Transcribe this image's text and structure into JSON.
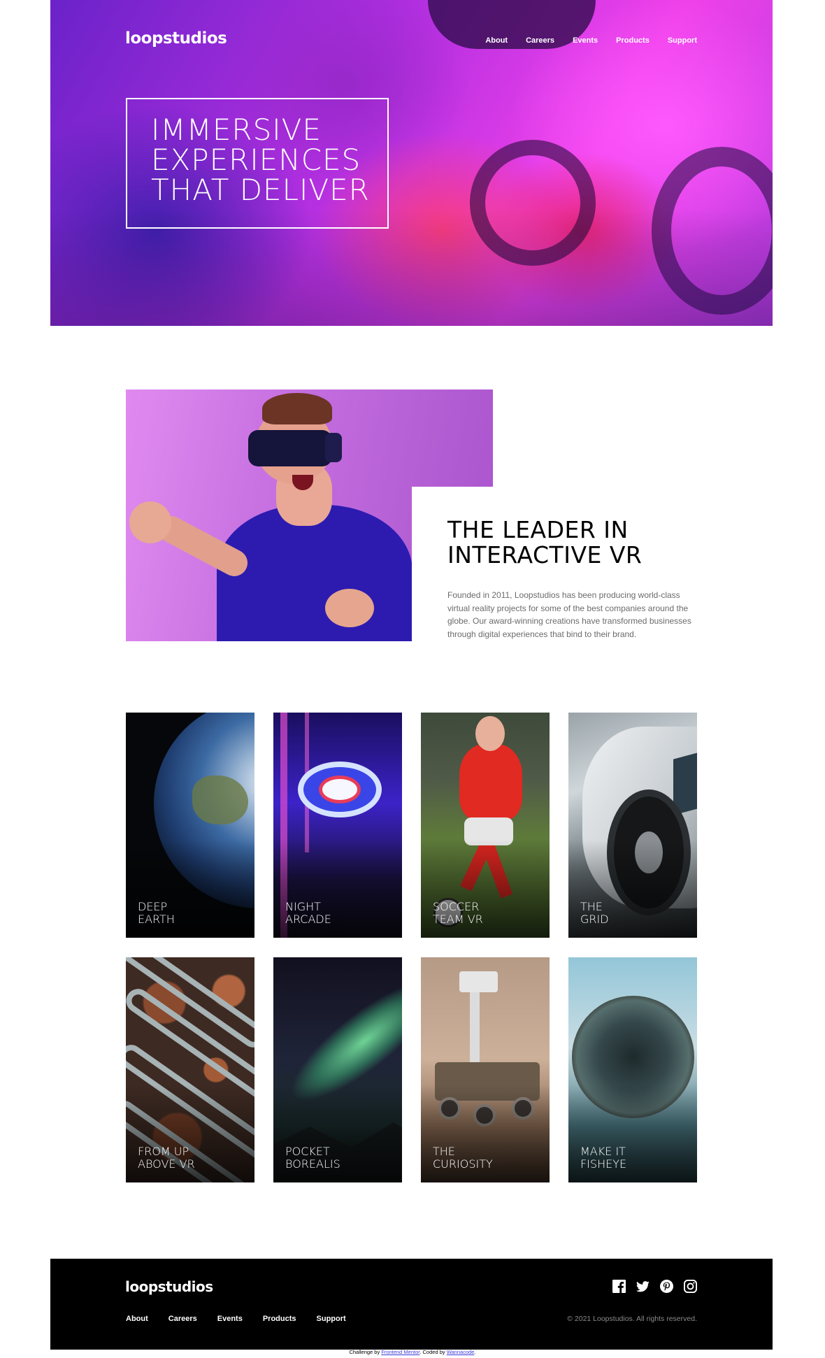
{
  "brand": "loopstudios",
  "nav": [
    "About",
    "Careers",
    "Events",
    "Products",
    "Support"
  ],
  "hero": {
    "headline": [
      "IMMERSIVE",
      "EXPERIENCES",
      "THAT DELIVER"
    ]
  },
  "intro": {
    "title": [
      "THE LEADER IN",
      "INTERACTIVE VR"
    ],
    "body": "Founded in 2011, Loopstudios has been producing world-class virtual reality projects for some of the best companies around the globe. Our award-winning creations have transformed businesses through digital experiences that bind to their brand."
  },
  "creations": [
    {
      "title": [
        "DEEP",
        "EARTH"
      ]
    },
    {
      "title": [
        "NIGHT",
        "ARCADE"
      ]
    },
    {
      "title": [
        "SOCCER",
        "TEAM VR"
      ]
    },
    {
      "title": [
        "THE",
        "GRID"
      ]
    },
    {
      "title": [
        "FROM UP",
        "ABOVE VR"
      ]
    },
    {
      "title": [
        "POCKET",
        "BOREALIS"
      ]
    },
    {
      "title": [
        "THE",
        "CURIOSITY"
      ]
    },
    {
      "title": [
        "MAKE IT",
        "FISHEYE"
      ]
    }
  ],
  "footer": {
    "social": [
      "facebook-icon",
      "twitter-icon",
      "pinterest-icon",
      "instagram-icon"
    ],
    "copyright": "© 2021 Loopstudios. All rights reserved."
  },
  "attribution": {
    "prefix": "Challenge by ",
    "link1": "Frontend Mentor",
    "middle": ". Coded by ",
    "link2": "Wannacode",
    "suffix": "."
  },
  "colors": {
    "footer_bg": "#000000",
    "text_gray": "#6b6b6b"
  }
}
